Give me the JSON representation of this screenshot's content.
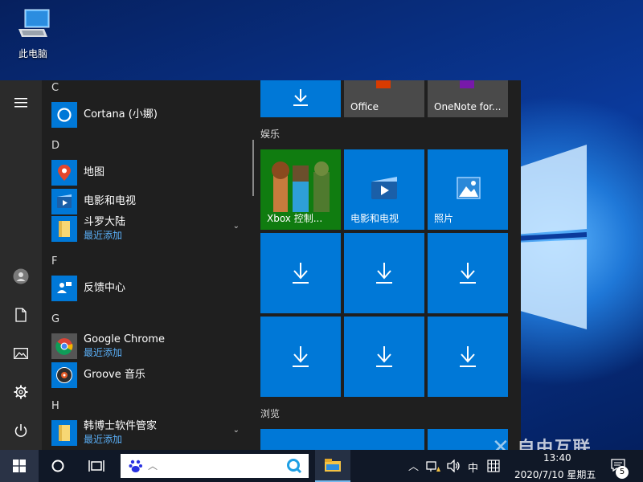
{
  "desktop": {
    "icon_label": "此电脑"
  },
  "watermark": "自由互联",
  "start_menu": {
    "sections": [
      {
        "letter": "C",
        "apps": [
          {
            "name": "Cortana (小娜)",
            "icon": "cortana-icon"
          }
        ]
      },
      {
        "letter": "D",
        "apps": [
          {
            "name": "地图",
            "icon": "maps-icon"
          },
          {
            "name": "电影和电视",
            "icon": "movies-tv-icon"
          },
          {
            "name": "斗罗大陆",
            "sub": "最近添加",
            "icon": "folder-icon"
          }
        ]
      },
      {
        "letter": "F",
        "apps": [
          {
            "name": "反馈中心",
            "icon": "feedback-hub-icon"
          }
        ]
      },
      {
        "letter": "G",
        "apps": [
          {
            "name": "Google Chrome",
            "sub": "最近添加",
            "icon": "chrome-icon"
          },
          {
            "name": "Groove 音乐",
            "icon": "groove-music-icon"
          }
        ]
      },
      {
        "letter": "H",
        "apps": [
          {
            "name": "韩博士软件管家",
            "sub": "最近添加",
            "icon": "folder-icon"
          }
        ]
      }
    ],
    "tiles": {
      "top": [
        {
          "label": ""
        },
        {
          "label": "Office"
        },
        {
          "label": "OneNote for..."
        }
      ],
      "entertainment_title": "娱乐",
      "entertainment": [
        {
          "label": "Xbox 控制..."
        },
        {
          "label": "电影和电视"
        },
        {
          "label": "照片"
        }
      ],
      "browse_title": "浏览"
    }
  },
  "taskbar": {
    "time": "13:40",
    "date": "2020/7/10 星期五",
    "ime": "中",
    "notification_count": "5"
  },
  "colors": {
    "accent": "#0078d7",
    "link": "#5aaef5",
    "taskbar": "#101827",
    "menu": "#1f1f1f"
  }
}
